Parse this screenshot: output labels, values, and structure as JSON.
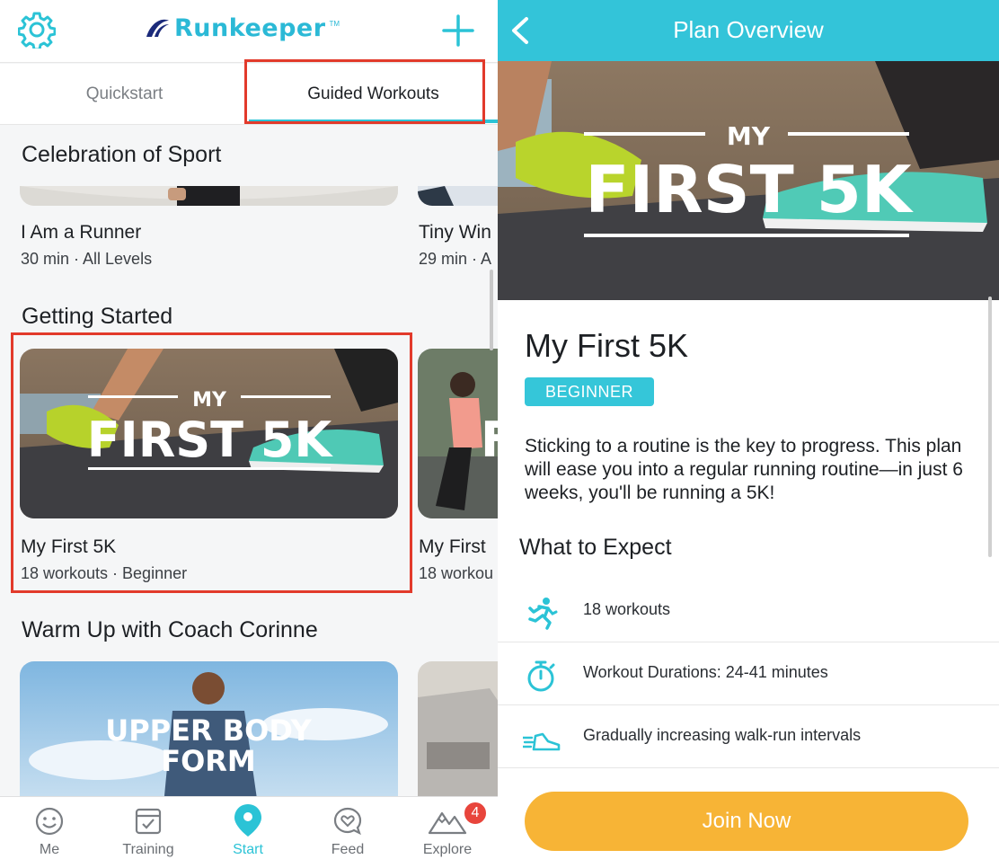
{
  "left_screen": {
    "header": {
      "brand": "Runkeeper",
      "brand_tm": "TM",
      "brand_color": "#2bb9d6",
      "accent_color": "#2bc3d6"
    },
    "tabs": [
      {
        "label": "Quickstart",
        "active": false
      },
      {
        "label": "Guided Workouts",
        "active": true
      }
    ],
    "sections": [
      {
        "title": "Celebration of Sport",
        "cards": [
          {
            "title": "I Am a Runner",
            "subtitle": "30 min · All Levels"
          },
          {
            "title": "Tiny Win",
            "subtitle": "29 min · A"
          }
        ]
      },
      {
        "title": "Getting Started",
        "cards": [
          {
            "title": "My First 5K",
            "subtitle": "18 workouts · Beginner",
            "image_overlay_top": "MY",
            "image_overlay_main": "FIRST 5K"
          },
          {
            "title": "My First",
            "subtitle": "18 workou",
            "image_overlay_main": "F"
          }
        ]
      },
      {
        "title": "Warm Up with Coach Corinne",
        "cards": [
          {
            "image_overlay_line1": "UPPER BODY",
            "image_overlay_line2": "FORM"
          },
          {
            "image_overlay_main": ""
          }
        ]
      }
    ],
    "bottom_nav": [
      {
        "label": "Me",
        "icon": "smiley-icon",
        "active": false
      },
      {
        "label": "Training",
        "icon": "checklist-icon",
        "active": false
      },
      {
        "label": "Start",
        "icon": "location-pin-icon",
        "active": true
      },
      {
        "label": "Feed",
        "icon": "heart-bubble-icon",
        "active": false
      },
      {
        "label": "Explore",
        "icon": "mountains-icon",
        "active": false,
        "badge": "4"
      }
    ]
  },
  "right_screen": {
    "header_title": "Plan Overview",
    "hero": {
      "overlay_top": "MY",
      "overlay_main": "FIRST 5K"
    },
    "plan_name": "My First 5K",
    "level": "BEGINNER",
    "description": "Sticking to a routine is the key to progress. This plan will ease you into a regular running routine—in just 6 weeks, you'll be running a 5K!",
    "expect_title": "What to Expect",
    "expect_items": [
      {
        "icon": "runner-icon",
        "text": "18 workouts"
      },
      {
        "icon": "stopwatch-icon",
        "text": "Workout Durations: 24-41 minutes"
      },
      {
        "icon": "shoe-icon",
        "text": "Gradually increasing walk-run intervals"
      }
    ],
    "join_button": "Join Now",
    "header_color": "#33c4d9",
    "button_color": "#f7b436"
  }
}
